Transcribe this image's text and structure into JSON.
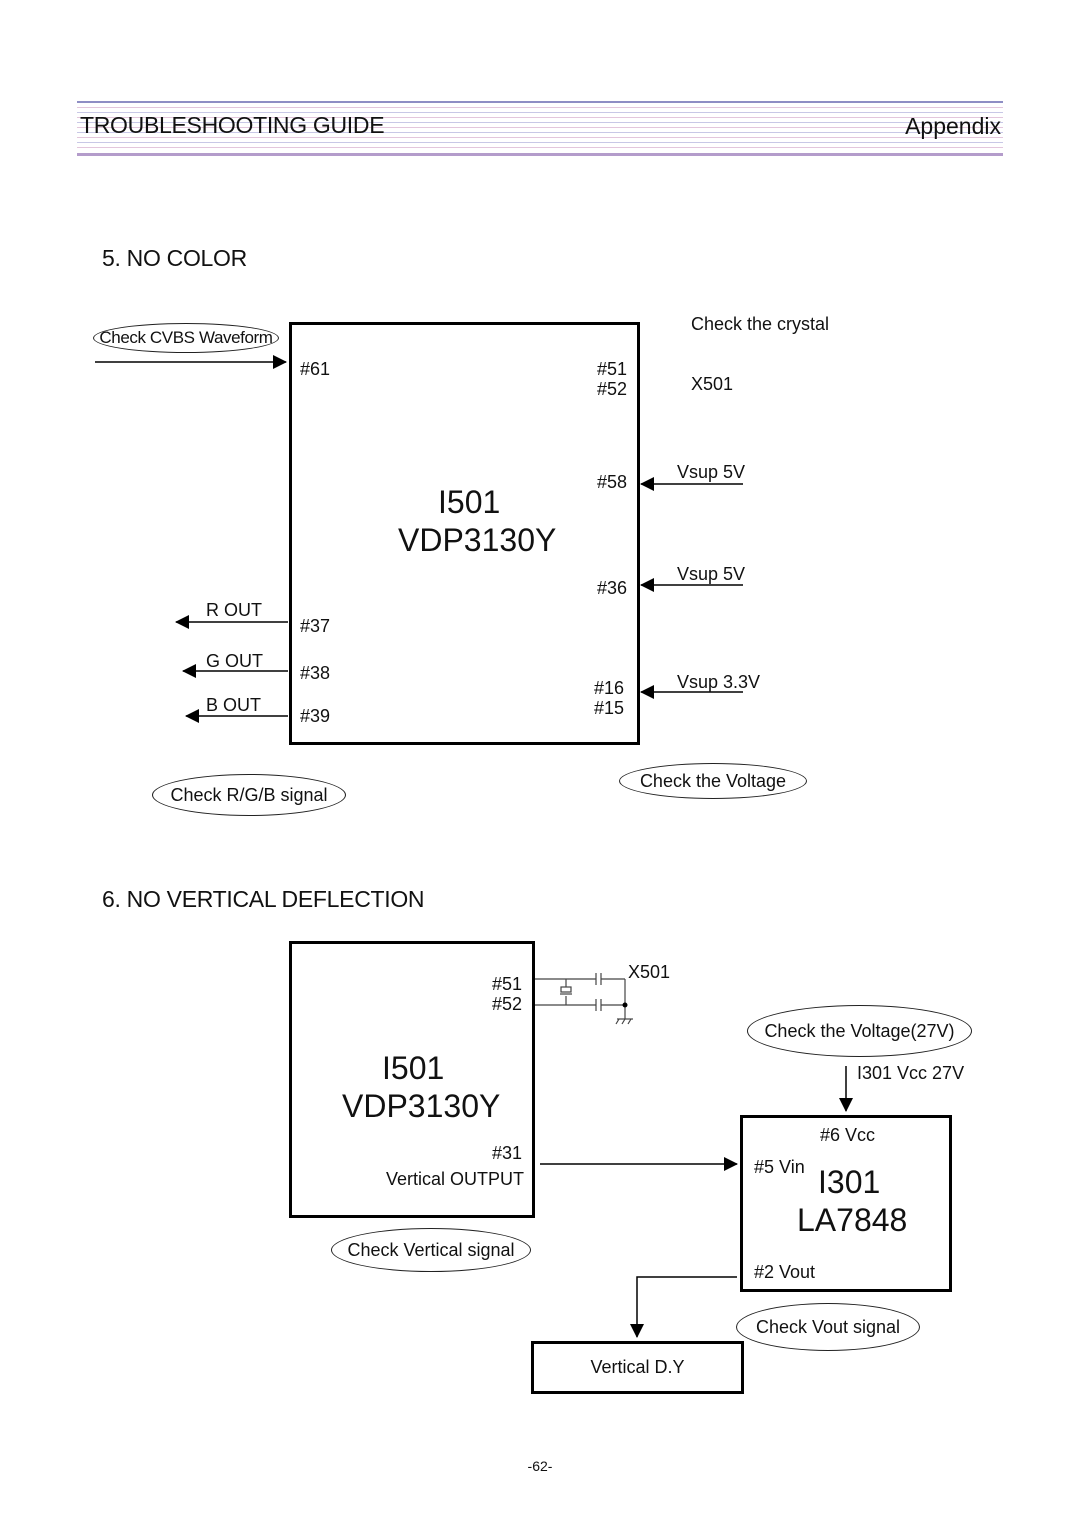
{
  "header": {
    "title": "TROUBLESHOOTING GUIDE",
    "section": "Appendix"
  },
  "no_color": {
    "heading": "5. NO COLOR",
    "chip_name": "I501",
    "chip_model": "VDP3130Y",
    "input_check": "Check CVBS Waveform",
    "pin_input": "#61",
    "pin_xtal_a": "#51",
    "pin_xtal_b": "#52",
    "crystal_check": "Check the crystal",
    "crystal_ref": "X501",
    "pin_58": "#58",
    "supply_58": "Vsup 5V",
    "pin_36": "#36",
    "supply_36": "Vsup 5V",
    "pin_16": "#16",
    "pin_15": "#15",
    "supply_16": "Vsup 3.3V",
    "voltage_check": "Check the Voltage",
    "outputs": [
      {
        "label": "R OUT",
        "pin": "#37"
      },
      {
        "label": "G OUT",
        "pin": "#38"
      },
      {
        "label": "B OUT",
        "pin": "#39"
      }
    ],
    "rgb_check": "Check R/G/B signal"
  },
  "no_vertical": {
    "heading": "6. NO VERTICAL DEFLECTION",
    "chip_name": "I501",
    "chip_model": "VDP3130Y",
    "pin_xtal_a": "#51",
    "pin_xtal_b": "#52",
    "crystal_ref": "X501",
    "pin_31": "#31",
    "pin_31_label": "Vertical OUTPUT",
    "vertical_check": "Check Vertical signal",
    "voltage_check": "Check the Voltage(27V)",
    "vcc_label": "I301 Vcc 27V",
    "amp_pin_vcc": "#6 Vcc",
    "amp_pin_vin": "#5 Vin",
    "amp_name": "I301",
    "amp_model": "LA7848",
    "amp_pin_vout": "#2 Vout",
    "vout_check": "Check Vout signal",
    "yoke_label": "Vertical D.Y"
  },
  "footer": {
    "page_number": "-62-"
  }
}
